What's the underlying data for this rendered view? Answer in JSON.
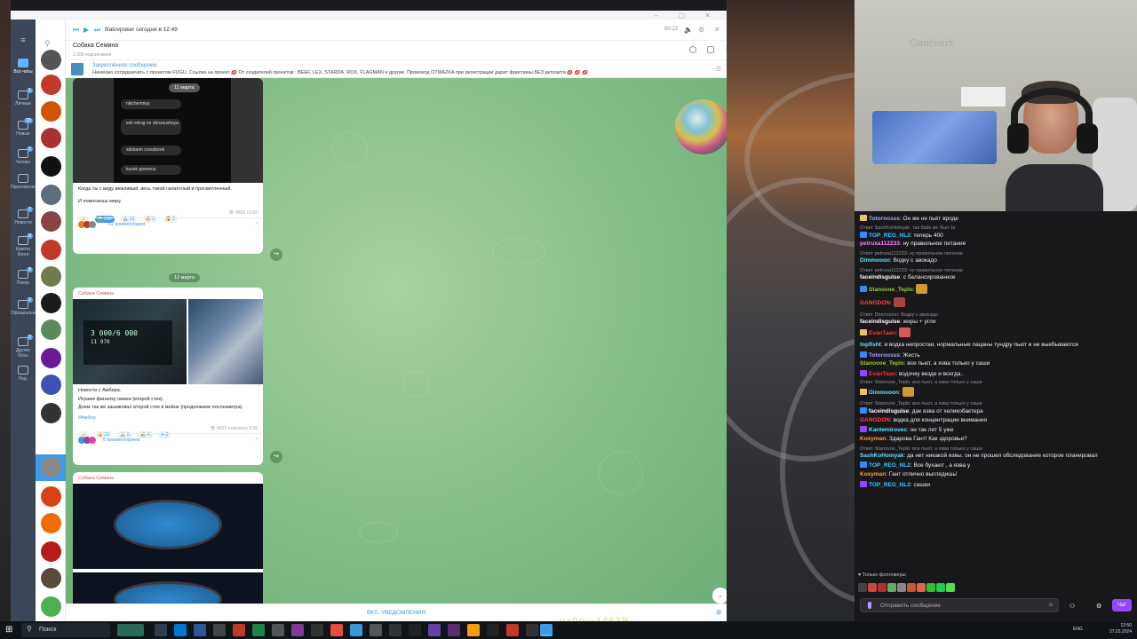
{
  "telegram": {
    "folders": [
      {
        "label": "Все чаты",
        "count": ""
      },
      {
        "label": "Личные",
        "count": "1"
      },
      {
        "label": "Новые",
        "count": "33"
      },
      {
        "label": "Чатики",
        "count": "2"
      },
      {
        "label": "Приложения",
        "count": ""
      },
      {
        "label": "Новости",
        "count": "7"
      },
      {
        "label": "Крипто блоги",
        "count": "8"
      },
      {
        "label": "Покер",
        "count": "8"
      },
      {
        "label": "Официальные",
        "count": "2"
      },
      {
        "label": "Другие боты",
        "count": "2"
      },
      {
        "label": "Ред.",
        "count": ""
      }
    ],
    "player": {
      "name": "filatovpoker",
      "when": "сегодня в 12:49",
      "time": "00:12"
    },
    "chat": {
      "title": "Собака Семина",
      "subtitle": "3 350 подписчиков"
    },
    "pinned": {
      "title": "Закреплённое сообщение",
      "text": "Начинаю сотрудничать с проектом FUGU. Ссылка на проект 💋 От создателей проектов : BEEF, LEX, STARDA, ROX, FLAGMAN и другие. Промокод OTMAZKA при регистрации дарит фриспины БЕЗ депозита 💋 💋 💋"
    },
    "post1": {
      "phone_messages": [
        "nikchemnuy",
        "esli vdrug ne obossushsya",
        "sdelaem crossbook",
        "kusok govneca"
      ],
      "phone_date": "11 марта",
      "text1": "Когда ты с виду вежливый, весь такой галантный и просветленный.",
      "text2": "И помогаешь миру.",
      "reactions": [
        "⭐",
        "😂 128",
        "🙏 13",
        "🔥 2",
        "😱 2"
      ],
      "views": "4608",
      "time": "13:09",
      "comments": "62 комментария"
    },
    "date_separator": "12 марта",
    "post2": {
      "author": "Собака Семина",
      "screen_text": "3 000/6 000",
      "screen_sub": "11 970",
      "text1": "Новости с Амбера.",
      "text2": "Играем финалку омахи (второй стек).",
      "text3": "Днем так же зашиковал второй стек в мейне (продолжаем послезавтра).",
      "tag": "#Амбер",
      "reactions": [
        "⭐",
        "👍 36",
        "🙏 8",
        "✍ 4",
        "❤ 2"
      ],
      "views": "4853",
      "edited": "изменено 2:38",
      "comments": "6 комментариев"
    },
    "post3": {
      "author": "Собака Семина"
    },
    "bottom": "ВКЛ. УВЕДОМЛЕНИЯ"
  },
  "colors": {
    "telegram_accent": "#3c9ae8",
    "twitch_purple": "#9147ff",
    "chat_bg": "#88c18a"
  },
  "cam": {
    "wall_text": "Gantvert"
  },
  "twitch": {
    "messages": [
      {
        "reply": "",
        "nick": "Totoroosss",
        "color": "#9fa8ff",
        "text": "Он же не пьёт вроде"
      },
      {
        "reply": "Ответ SashKoHomyak: так байк же был 1к",
        "nick": "",
        "color": "",
        "text": ""
      },
      {
        "reply": "",
        "nick": "TOP_REG_NL2",
        "color": "#3cf",
        "text": "теперь 400"
      },
      {
        "reply": "",
        "nick": "petruxa112233",
        "color": "#ff7fff",
        "text": "ну правильное питание"
      },
      {
        "reply": "Ответ petruxa112233: ну правильное питание",
        "nick": "",
        "color": "",
        "text": ""
      },
      {
        "reply": "",
        "nick": "Dimmooon",
        "color": "#60e0ff",
        "text": "Водку с авокадо"
      },
      {
        "reply": "Ответ petruxa112233: ну правильное питание",
        "nick": "",
        "color": "",
        "text": ""
      },
      {
        "reply": "",
        "nick": "faceindisguise",
        "color": "#ffffff",
        "text": "с балансированное"
      },
      {
        "reply": "",
        "nick": "Stanovoe_Teplo",
        "color": "#9acd32",
        "text": ""
      },
      {
        "reply": "",
        "nick": "GANGDON",
        "color": "#ff4040",
        "text": ""
      },
      {
        "reply": "Ответ Dimmooon: Водку с авокадо",
        "nick": "",
        "color": "",
        "text": ""
      },
      {
        "reply": "",
        "nick": "faceindisguise",
        "color": "#ffffff",
        "text": "жиры + угли"
      },
      {
        "reply": "",
        "nick": "EvanTaan",
        "color": "#ff3030",
        "text": ""
      },
      {
        "reply": "",
        "nick": "topfisht",
        "color": "#60e0ff",
        "text": "и водка непростая, нормальные пацаны тундру пьют и не выебываются"
      },
      {
        "reply": "",
        "nick": "Totoroosss",
        "color": "#9fa8ff",
        "text": "Жесть"
      },
      {
        "reply": "",
        "nick": "Stanovoe_Teplo",
        "color": "#9acd32",
        "text": "все пьют, а язва только у саши"
      },
      {
        "reply": "",
        "nick": "EvanTaan",
        "color": "#ff3030",
        "text": "водочку везде и всегда.."
      },
      {
        "reply": "Ответ Stanovoe_Teplo: все пьют, а язва только у саши",
        "nick": "",
        "color": "",
        "text": ""
      },
      {
        "reply": "",
        "nick": "Dimmooon",
        "color": "#60e0ff",
        "text": ""
      },
      {
        "reply": "Ответ Stanovoe_Teplo: все пьют, а язва только у саши",
        "nick": "",
        "color": "",
        "text": ""
      },
      {
        "reply": "",
        "nick": "faceindisguise",
        "color": "#ffffff",
        "text": "дак язва от хеликобактера"
      },
      {
        "reply": "",
        "nick": "GANGDON",
        "color": "#ff4040",
        "text": "водка для концентрации внимания"
      },
      {
        "reply": "",
        "nick": "Kantemirovec",
        "color": "#60e0ff",
        "text": "он так лет 5 уже"
      },
      {
        "reply": "",
        "nick": "Koxyman",
        "color": "#ff9f40",
        "text": "Здарова Гант! Как здоровье?"
      },
      {
        "reply": "Ответ Stanovoe_Teplo: все пьют, а язва только у саши",
        "nick": "",
        "color": "",
        "text": ""
      },
      {
        "reply": "",
        "nick": "SashKoHomyak",
        "color": "#60e0ff",
        "text": "да нет никакой язвы. он не прошел обследование которое планировал"
      },
      {
        "reply": "",
        "nick": "TOP_REG_NL2",
        "color": "#3cf",
        "text": "Все бухают , а язва у"
      },
      {
        "reply": "",
        "nick": "Koxyman",
        "color": "#ff9f40",
        "text": "Гант отлично выглядишь!"
      },
      {
        "reply": "",
        "nick": "TOP_REG_NL2",
        "color": "#3cf",
        "text": "сашки"
      }
    ],
    "followers_only": "Только фолловеры",
    "send_placeholder": "Отправить сообщение",
    "chat_button": "Чат"
  },
  "taskbar": {
    "search": "Поиск",
    "lang": "ENG",
    "time": "12:50",
    "date": "27.03.2024"
  },
  "overlay": "yx0o—1483P"
}
